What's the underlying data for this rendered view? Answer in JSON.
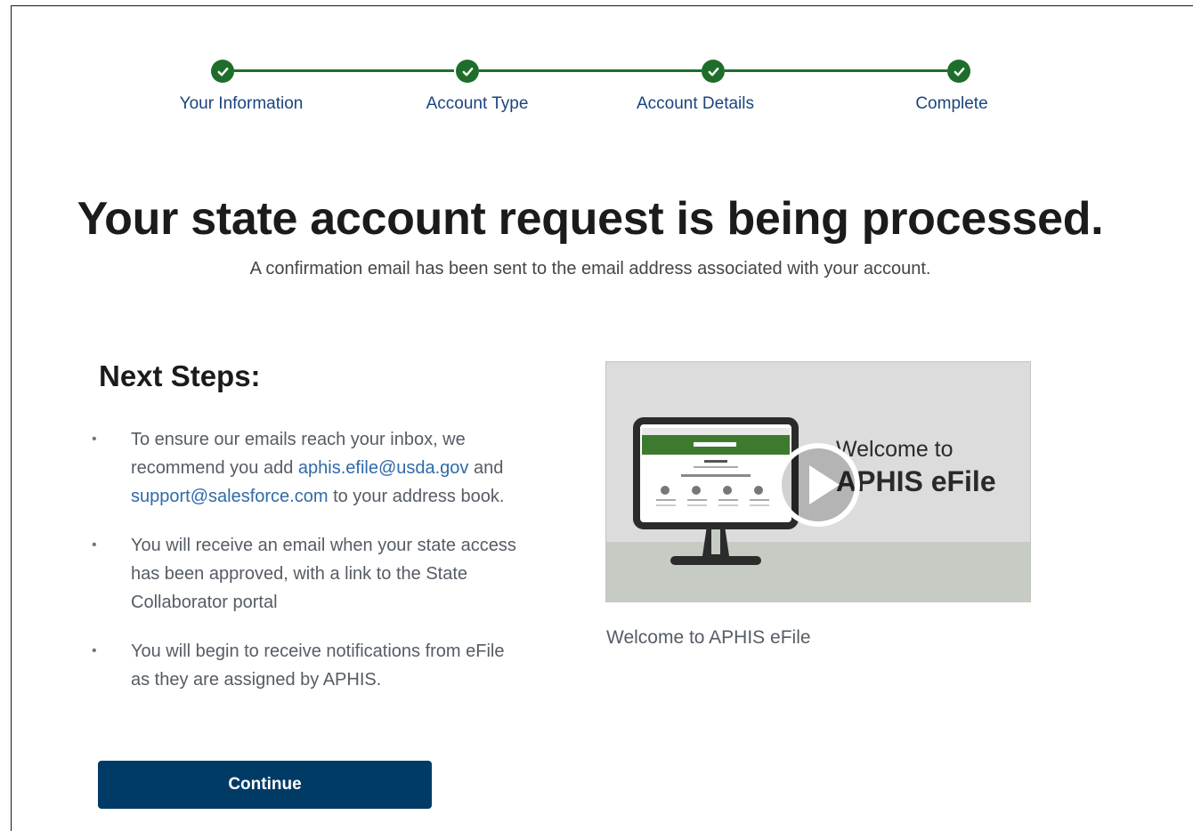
{
  "stepper": {
    "steps": [
      {
        "label": "Your Information",
        "status": "complete"
      },
      {
        "label": "Account Type",
        "status": "complete"
      },
      {
        "label": "Account Details",
        "status": "complete"
      },
      {
        "label": "Complete",
        "status": "complete"
      }
    ],
    "color": "#1f6d2b"
  },
  "main": {
    "headline": "Your state account request is being processed.",
    "subline": "A confirmation email has been sent to the email address associated with your account."
  },
  "next_steps": {
    "title": "Next Steps:",
    "item1": {
      "part1": "To ensure our emails reach your inbox, we recommend you add ",
      "link1": "aphis.efile@usda.gov",
      "part2": " and ",
      "link2": "support@salesforce.com",
      "part3": " to your address book."
    },
    "item2": "You will receive an email when your state access has been approved, with a link to the State Collaborator portal",
    "item3": "You will begin to receive notifications from eFile as they are assigned by APHIS."
  },
  "video": {
    "line1": "Welcome to",
    "line2": "APHIS eFile",
    "caption": "Welcome to APHIS eFile",
    "play_icon": "play-icon"
  },
  "actions": {
    "continue_label": "Continue",
    "button_color": "#003b66"
  }
}
